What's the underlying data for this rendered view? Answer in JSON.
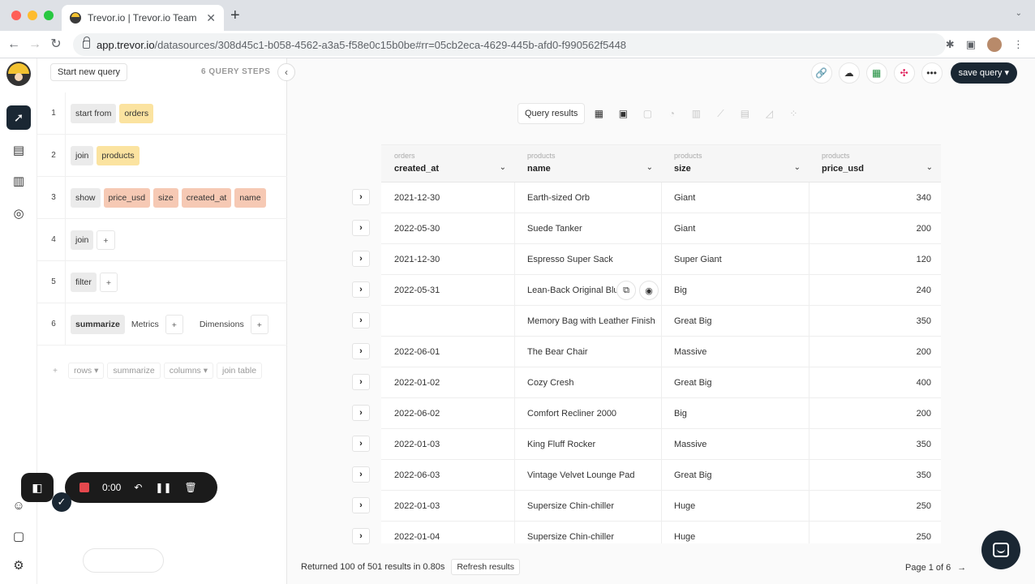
{
  "browser": {
    "tab_title": "Trevor.io | Trevor.io Team Sand",
    "new_tab": "+",
    "url_host": "app.trevor.io",
    "url_path": "/datasources/308d45c1-b058-4562-a3a5-f58e0c15b0be#rr=05cb2eca-4629-445b-afd0-f990562f5448"
  },
  "query_panel": {
    "start_new_query": "Start new query",
    "steps_label": "6 QUERY STEPS",
    "steps": [
      {
        "num": "1",
        "verb": "start from",
        "chips": [
          {
            "kind": "table",
            "text": "orders"
          }
        ]
      },
      {
        "num": "2",
        "verb": "join",
        "chips": [
          {
            "kind": "table",
            "text": "products"
          }
        ]
      },
      {
        "num": "3",
        "verb": "show",
        "chips": [
          {
            "kind": "col",
            "text": "price_usd"
          },
          {
            "kind": "col",
            "text": "size"
          },
          {
            "kind": "col",
            "text": "created_at"
          },
          {
            "kind": "col",
            "text": "name"
          }
        ]
      },
      {
        "num": "4",
        "verb": "join",
        "chips": [
          {
            "kind": "plus",
            "text": "+"
          }
        ]
      },
      {
        "num": "5",
        "verb": "filter",
        "chips": [
          {
            "kind": "plus",
            "text": "+"
          }
        ]
      },
      {
        "num": "6",
        "verb": "summarize",
        "chips": [
          {
            "kind": "plain",
            "text": "Metrics"
          },
          {
            "kind": "plus",
            "text": "+"
          },
          {
            "kind": "plain",
            "text": "Dimensions"
          },
          {
            "kind": "plus",
            "text": "+"
          }
        ]
      }
    ],
    "add_plus": "+",
    "add_options": [
      "rows ▾",
      "summarize",
      "columns ▾",
      "join table"
    ]
  },
  "recorder": {
    "time": "0:00"
  },
  "toolbar": {
    "save_query": "save query ▾",
    "query_results": "Query results"
  },
  "table": {
    "columns": [
      {
        "source": "orders",
        "name": "created_at"
      },
      {
        "source": "products",
        "name": "name"
      },
      {
        "source": "products",
        "name": "size"
      },
      {
        "source": "products",
        "name": "price_usd"
      }
    ],
    "rows": [
      [
        "2021-12-30",
        "Earth-sized Orb",
        "Giant",
        "340"
      ],
      [
        "2022-05-30",
        "Suede Tanker",
        "Giant",
        "200"
      ],
      [
        "2021-12-30",
        "Espresso Super Sack",
        "Super Giant",
        "120"
      ],
      [
        "2022-05-31",
        "Lean-Back Original Blu",
        "Big",
        "240"
      ],
      [
        "",
        "Memory Bag with Leather Finish",
        "Great Big",
        "350"
      ],
      [
        "2022-06-01",
        "The Bear Chair",
        "Massive",
        "200"
      ],
      [
        "2022-01-02",
        "Cozy Cresh",
        "Great Big",
        "400"
      ],
      [
        "2022-06-02",
        "Comfort Recliner 2000",
        "Big",
        "200"
      ],
      [
        "2022-01-03",
        "King Fluff Rocker",
        "Massive",
        "350"
      ],
      [
        "2022-06-03",
        "Vintage Velvet Lounge Pad",
        "Great Big",
        "350"
      ],
      [
        "2022-01-03",
        "Supersize Chin-chiller",
        "Huge",
        "250"
      ],
      [
        "2022-01-04",
        "Supersize Chin-chiller",
        "Huge",
        "250"
      ]
    ]
  },
  "footer": {
    "returned": "Returned 100 of 501 results in 0.80s",
    "refresh": "Refresh results",
    "page": "Page 1 of 6",
    "next": "→"
  },
  "colors": {
    "accent": "#1a2733",
    "table_chip": "#fbe3a0",
    "column_chip": "#f6c9b4",
    "record": "#e5484d"
  }
}
